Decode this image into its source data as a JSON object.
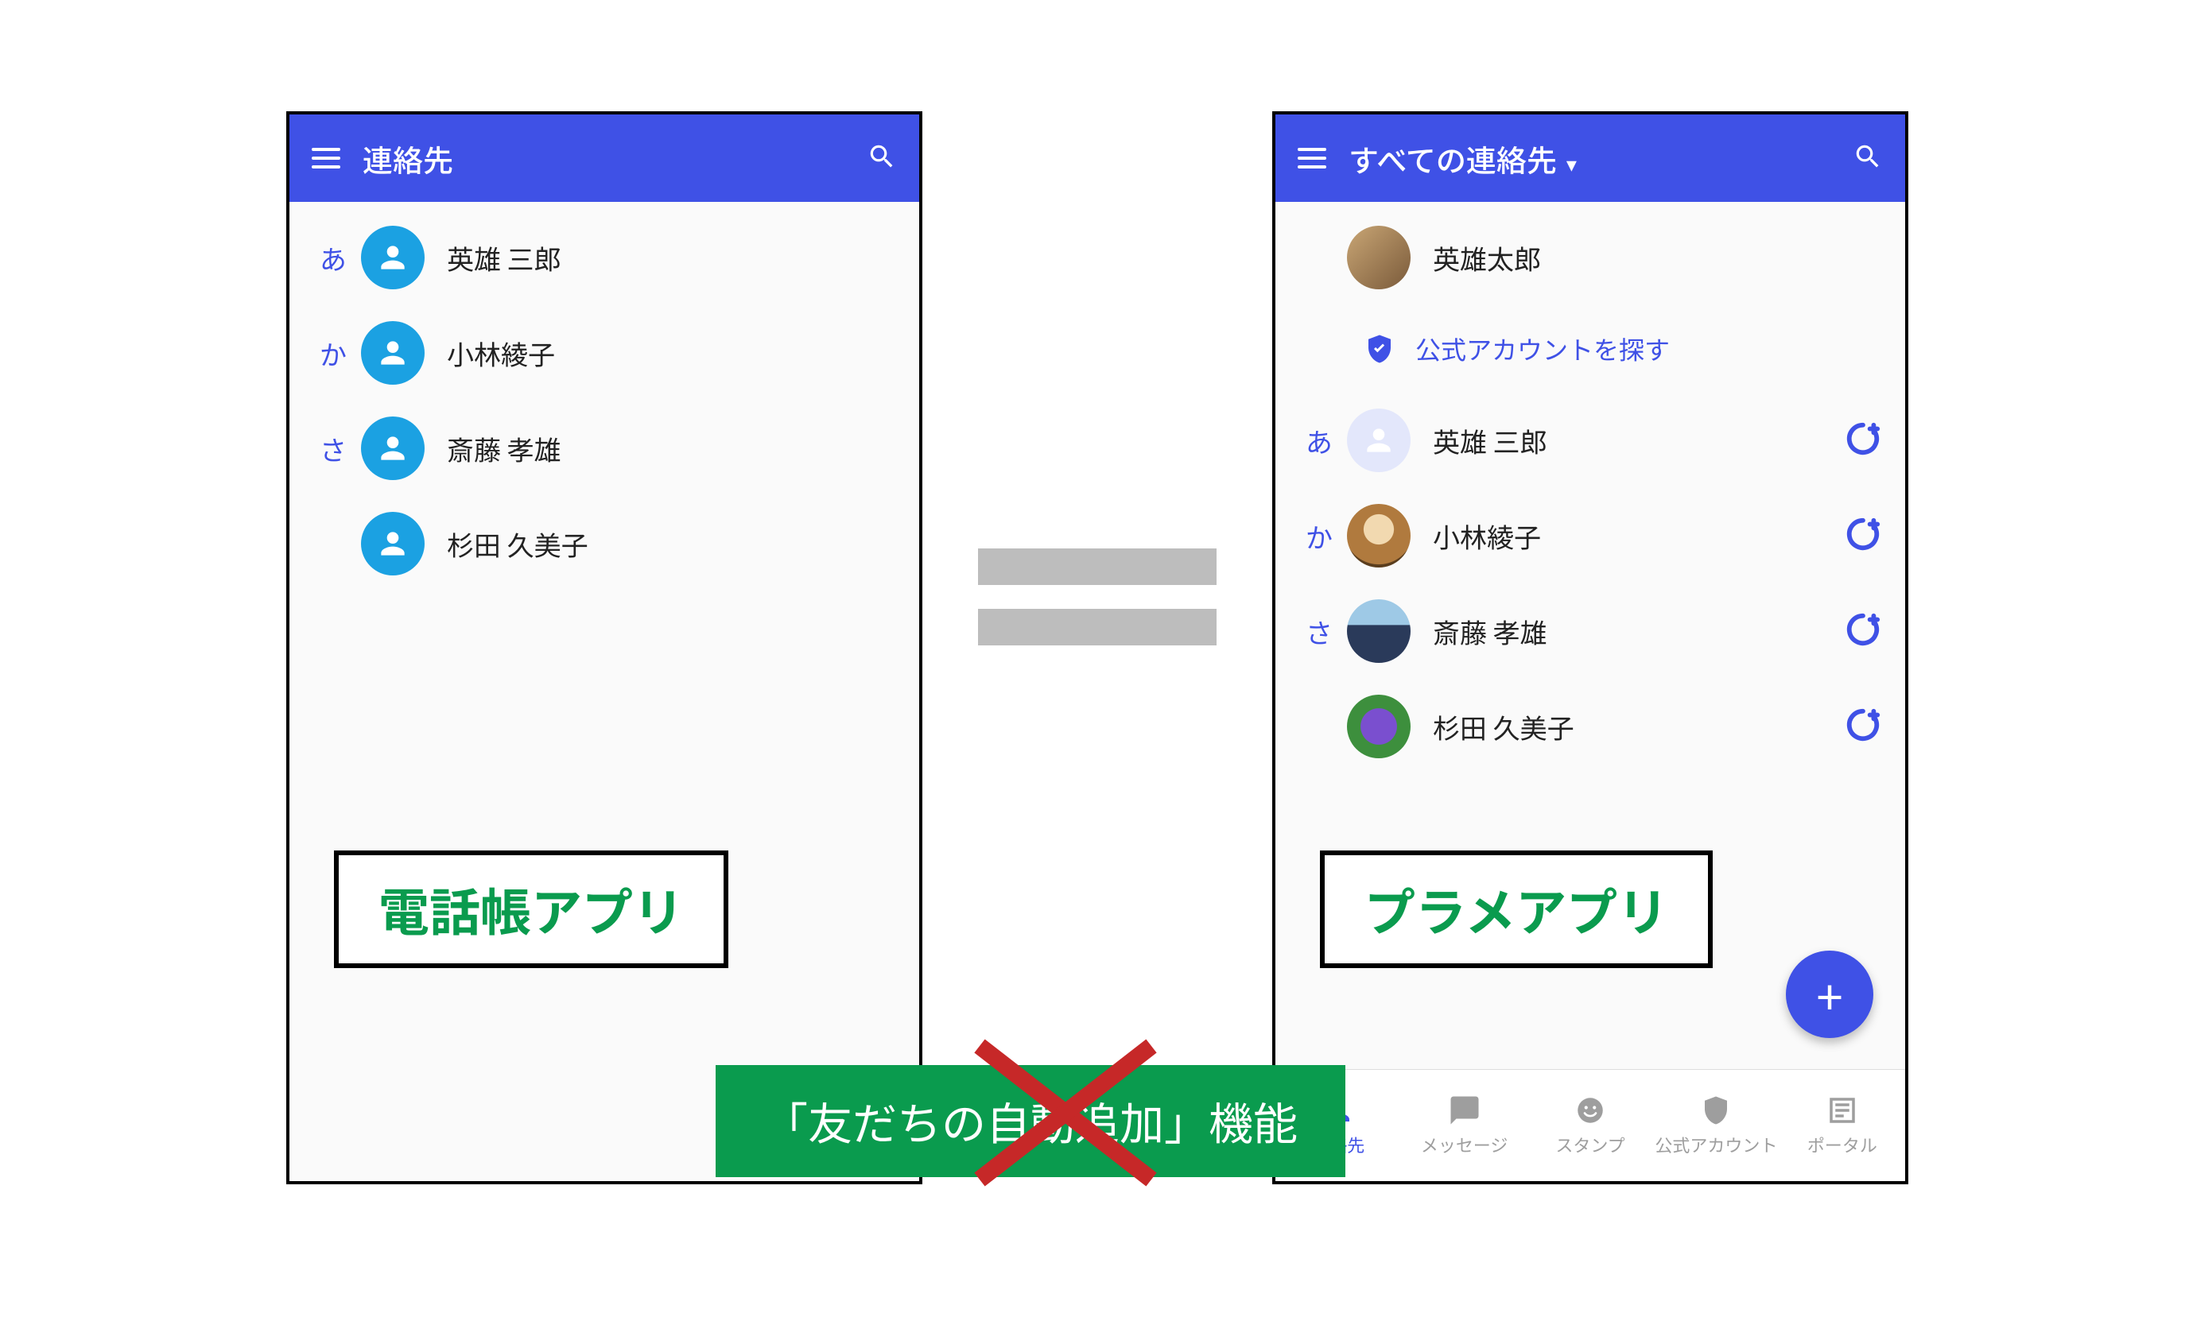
{
  "left_phone": {
    "title": "連絡先",
    "contacts": [
      {
        "index": "あ",
        "name": "英雄 三郎"
      },
      {
        "index": "か",
        "name": "小林綾子"
      },
      {
        "index": "さ",
        "name": "斎藤 孝雄"
      },
      {
        "index": "",
        "name": "杉田 久美子"
      }
    ]
  },
  "right_phone": {
    "title": "すべての連絡先",
    "profile_name": "英雄太郎",
    "official_search": "公式アカウントを探す",
    "contacts": [
      {
        "index": "あ",
        "name": "英雄 三郎"
      },
      {
        "index": "か",
        "name": "小林綾子"
      },
      {
        "index": "さ",
        "name": "斎藤 孝雄"
      },
      {
        "index": "",
        "name": "杉田 久美子"
      }
    ],
    "bottom_nav": {
      "contacts": "連絡先",
      "messages": "メッセージ",
      "stamps": "スタンプ",
      "official": "公式アカウント",
      "portal": "ポータル"
    }
  },
  "caption_left": "電話帳アプリ",
  "caption_right": "プラメアプリ",
  "banner": "「友だちの自動追加」機能"
}
